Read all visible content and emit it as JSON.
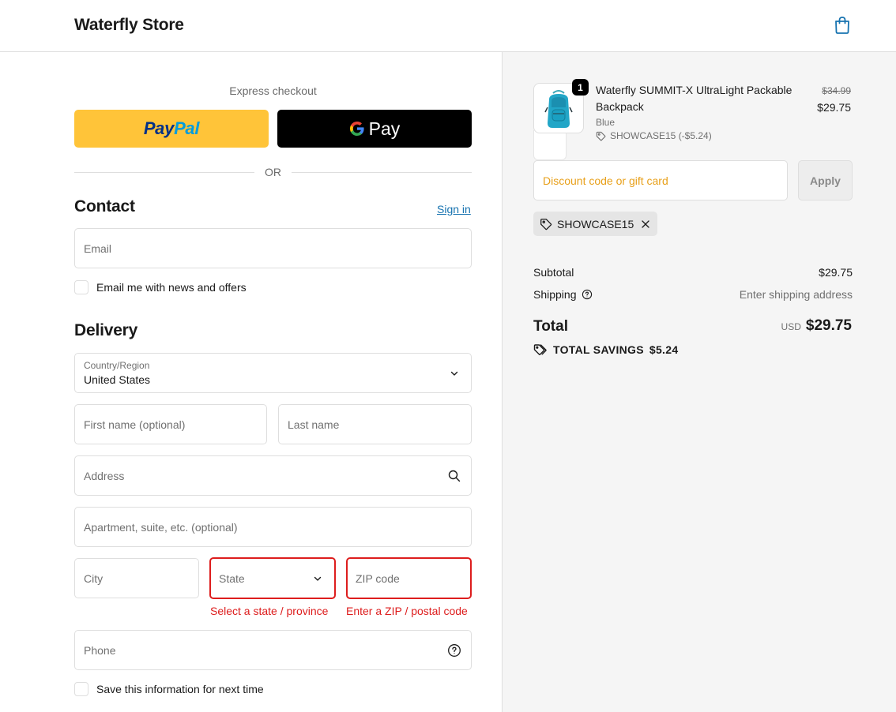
{
  "header": {
    "store_name": "Waterfly Store",
    "cart_icon": "shopping-bag-icon"
  },
  "express": {
    "label": "Express checkout",
    "paypal_pay": "Pay",
    "paypal_pal": "Pal",
    "gpay_label": "Pay",
    "divider_text": "OR"
  },
  "contact": {
    "title": "Contact",
    "sign_in": "Sign in",
    "email_placeholder": "Email",
    "newsletter_label": "Email me with news and offers"
  },
  "delivery": {
    "title": "Delivery",
    "country_label": "Country/Region",
    "country_value": "United States",
    "first_name_placeholder": "First name (optional)",
    "last_name_placeholder": "Last name",
    "address_placeholder": "Address",
    "apartment_placeholder": "Apartment, suite, etc. (optional)",
    "city_placeholder": "City",
    "state_placeholder": "State",
    "zip_placeholder": "ZIP code",
    "state_error": "Select a state / province",
    "zip_error": "Enter a ZIP / postal code",
    "phone_placeholder": "Phone",
    "save_info_label": "Save this information for next time"
  },
  "summary": {
    "product": {
      "name": "Waterfly SUMMIT-X UltraLight Packable Backpack",
      "variant": "Blue",
      "discount_line": "SHOWCASE15 (-$5.24)",
      "quantity": "1",
      "price_original": "$34.99",
      "price_current": "$29.75"
    },
    "discount_placeholder": "Discount code or gift card",
    "apply_label": "Apply",
    "applied_code": "SHOWCASE15",
    "subtotal_label": "Subtotal",
    "subtotal_value": "$29.75",
    "shipping_label": "Shipping",
    "shipping_value": "Enter shipping address",
    "total_label": "Total",
    "currency": "USD",
    "total_value": "$29.75",
    "savings_label": "TOTAL SAVINGS",
    "savings_value": "$5.24"
  },
  "colors": {
    "paypal_yellow": "#ffc439",
    "link_blue": "#1773b0",
    "error_red": "#dd1d1d",
    "discount_placeholder": "#e8a01a"
  }
}
